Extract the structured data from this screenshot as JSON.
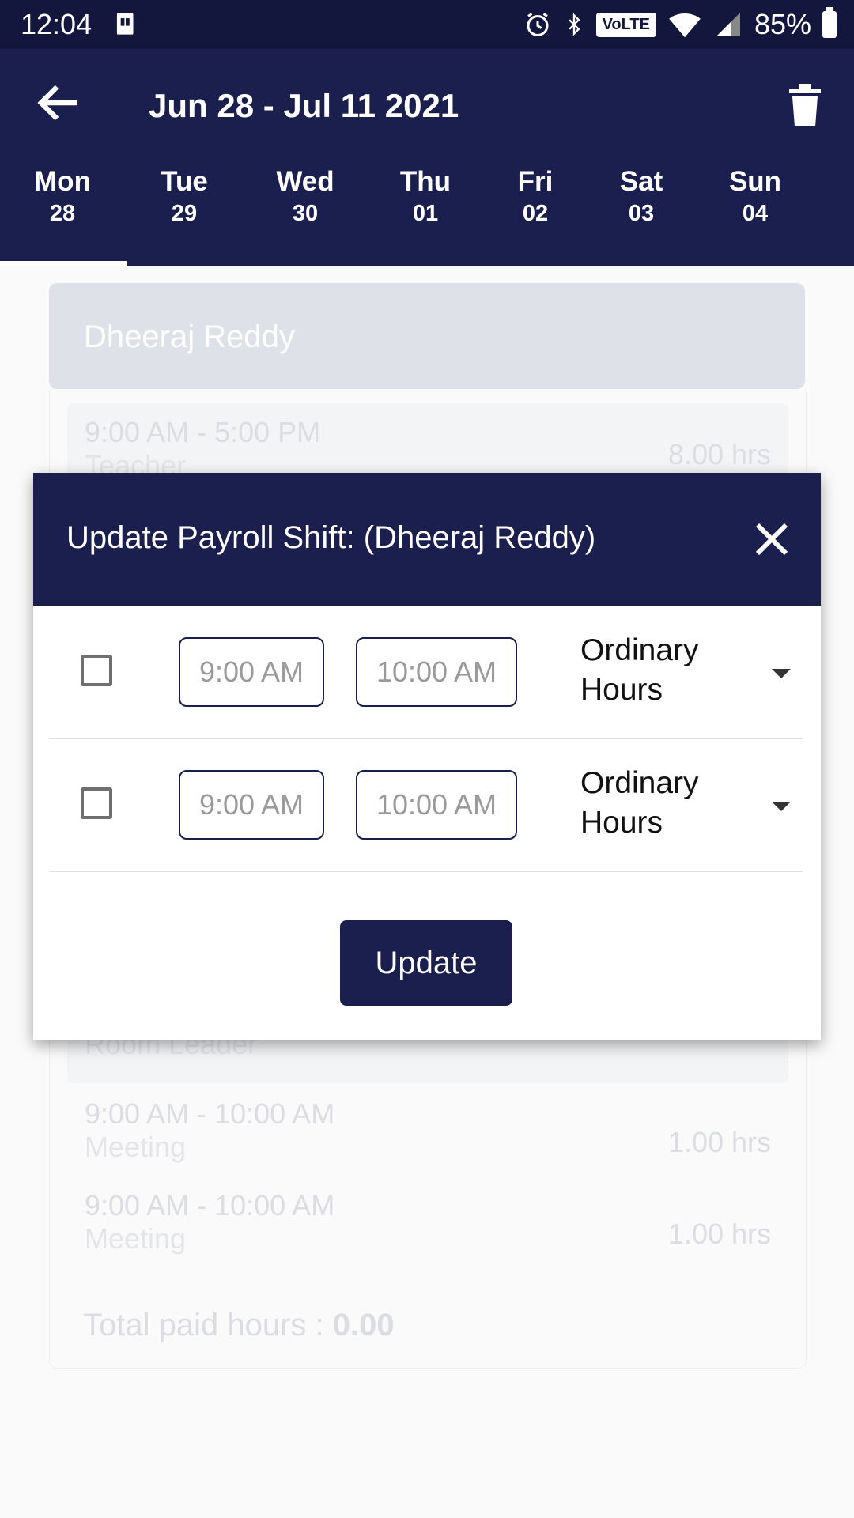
{
  "status_bar": {
    "time": "12:04",
    "battery": "85%",
    "volte": "VoLTE"
  },
  "header": {
    "title": "Jun 28 - Jul 11 2021"
  },
  "days": [
    {
      "name": "Mon",
      "date": "28"
    },
    {
      "name": "Tue",
      "date": "29"
    },
    {
      "name": "Wed",
      "date": "30"
    },
    {
      "name": "Thu",
      "date": "01"
    },
    {
      "name": "Fri",
      "date": "02"
    },
    {
      "name": "Sat",
      "date": "03"
    },
    {
      "name": "Sun",
      "date": "04"
    }
  ],
  "background": {
    "employee_name": "Dheeraj  Reddy",
    "shifts": [
      {
        "time": "9:00 AM - 5:00 PM",
        "role": "Teacher",
        "hours": "8.00 hrs"
      },
      {
        "role": "Room Leader"
      },
      {
        "time": "9:00 AM - 10:00 AM",
        "role": "Meeting",
        "hours": "1.00 hrs"
      },
      {
        "time": "9:00 AM - 10:00 AM",
        "role": "Meeting",
        "hours": "1.00 hrs"
      }
    ],
    "total_label": "Total paid hours : ",
    "total_value": "0.00"
  },
  "dialog": {
    "title": "Update Payroll Shift: (Dheeraj  Reddy)",
    "rows": [
      {
        "start_placeholder": "9:00 AM",
        "end_placeholder": "10:00 AM",
        "type": "Ordinary Hours"
      },
      {
        "start_placeholder": "9:00 AM",
        "end_placeholder": "10:00 AM",
        "type": "Ordinary Hours"
      }
    ],
    "update_label": "Update"
  }
}
